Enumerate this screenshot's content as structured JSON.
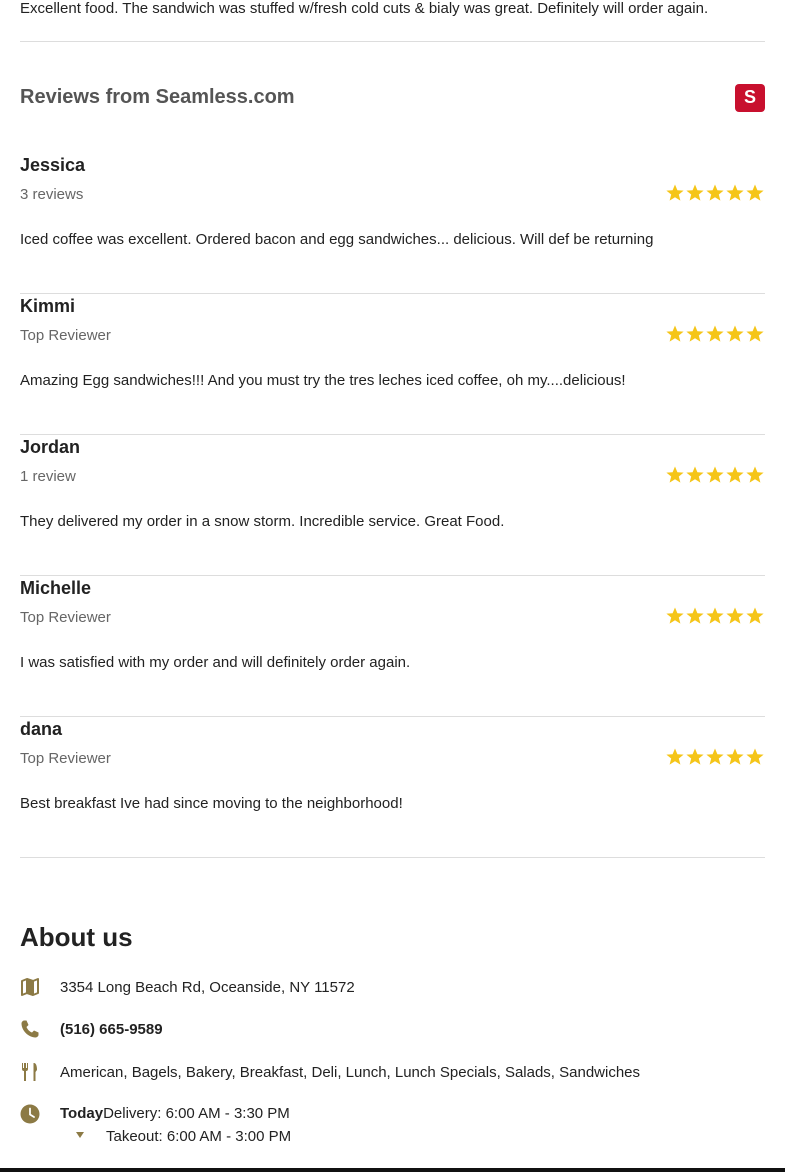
{
  "top_review": {
    "text": "Excellent food. The sandwich was stuffed w/fresh cold cuts & bialy was great. Definitely will order again."
  },
  "reviews_section": {
    "title": "Reviews from Seamless.com",
    "logo_letter": "S",
    "brand_color": "#c8102e",
    "star_color": "#f5c518"
  },
  "reviews": [
    {
      "name": "Jessica",
      "meta": "3 reviews",
      "rating": 5,
      "text": "Iced coffee was excellent. Ordered bacon and egg sandwiches... delicious. Will def be returning"
    },
    {
      "name": "Kimmi",
      "meta": "Top Reviewer",
      "rating": 5,
      "text": "Amazing Egg sandwiches!!! And you must try the tres leches iced coffee, oh my....delicious!"
    },
    {
      "name": "Jordan",
      "meta": "1 review",
      "rating": 5,
      "text": "They delivered my order in a snow storm. Incredible service. Great Food."
    },
    {
      "name": "Michelle",
      "meta": "Top Reviewer",
      "rating": 5,
      "text": "I was satisfied with my order and will definitely order again."
    },
    {
      "name": "dana",
      "meta": "Top Reviewer",
      "rating": 5,
      "text": "Best breakfast Ive had since moving to the neighborhood!"
    }
  ],
  "about": {
    "title": "About us",
    "address": "3354 Long Beach Rd, Oceanside, NY 11572",
    "phone": "(516) 665-9589",
    "cuisines": "American, Bagels, Bakery, Breakfast, Deli, Lunch, Lunch Specials, Salads, Sandwiches",
    "hours": {
      "today_label": "Today",
      "delivery": "Delivery: 6:00 AM - 3:30 PM",
      "takeout": "Takeout: 6:00 AM - 3:00 PM"
    },
    "icon_color": "#8c7a45",
    "icons": [
      "map-icon",
      "phone-icon",
      "utensils-icon",
      "clock-icon",
      "chevron-down-icon"
    ]
  }
}
